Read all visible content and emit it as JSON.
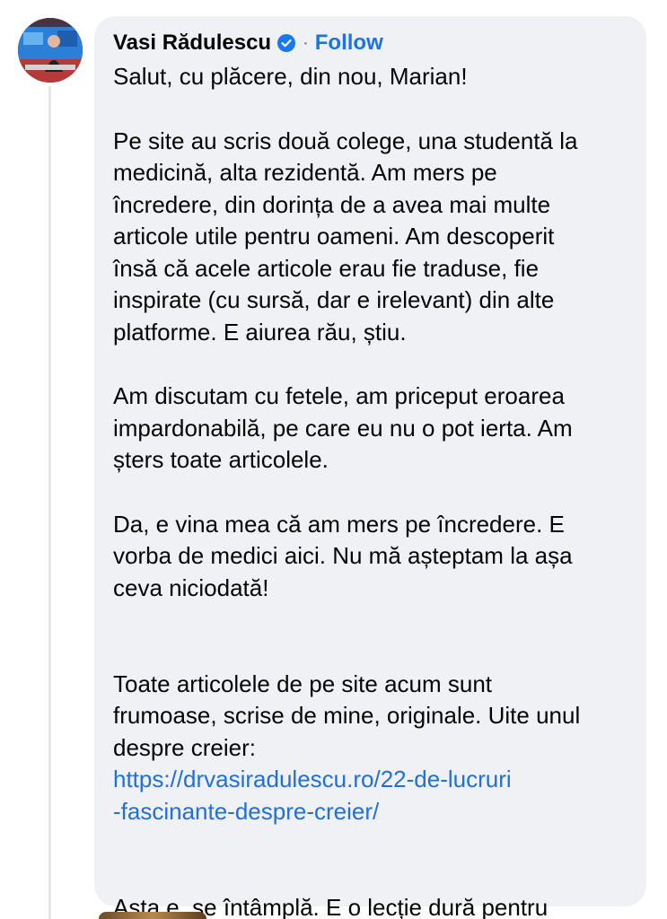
{
  "comment": {
    "author_name": "Vasi Rădulescu",
    "verified_icon": "verified-badge-icon",
    "separator": "·",
    "follow_label": "Follow",
    "greeting": "Salut, cu plăcere, din nou, Marian!",
    "paragraph_1": "Pe site au scris două colege, una studentă la\nmedicină, alta rezidentă. Am mers pe\nîncredere, din dorința de a avea mai multe\narticole utile pentru oameni. Am descoperit\nînsă că acele articole erau fie traduse, fie\ninspirate (cu sursă, dar e irelevant) din alte\nplatforme. E aiurea rău, știu.",
    "paragraph_2": "Am discutam cu fetele, am priceput eroarea\nimpardonabilă, pe care eu nu o pot ierta. Am\nșters toate articolele.",
    "paragraph_3": "Da, e vina mea că am mers pe încredere. E\nvorba de medici aici. Nu mă așteptam la așa\nceva niciodată!",
    "paragraph_4": "Toate articolele de pe site acum sunt\nfrumoase, scrise de mine, originale. Uite unul\ndespre creier:",
    "link_text": "https://drvasiradulescu.ro/22-de-lucruri\n-fascinante-despre-creier/",
    "paragraph_5": "Asta e, se întâmplă. E o lecție dură pentru\nmine. Merg înainte și am învățat de aici."
  },
  "colors": {
    "bubble_background": "#eff1f4",
    "follow_blue": "#1b74e4",
    "link_blue": "#216fdb",
    "verified_blue": "#1877f2"
  }
}
